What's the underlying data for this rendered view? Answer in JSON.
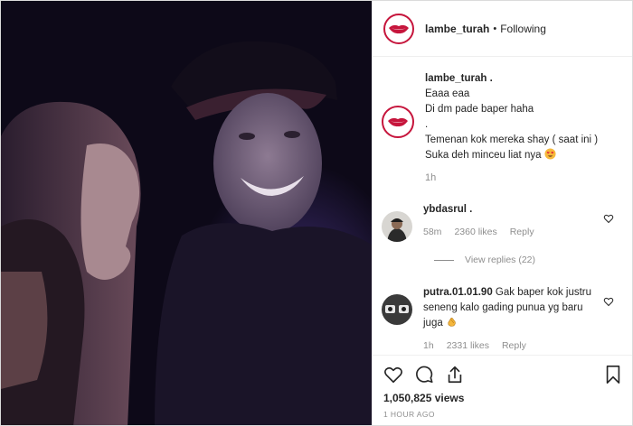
{
  "post": {
    "account": {
      "username": "lambe_turah",
      "separator": "•",
      "follow_status": "Following"
    },
    "caption": {
      "username": "lambe_turah .",
      "lines": [
        "Eaaa eaa",
        "Di dm pade baper haha",
        ".",
        "Temenan kok mereka shay ( saat ini )",
        "Suka deh minceu liat nya"
      ],
      "emoji": "heart-eyes-emoji",
      "time": "1h"
    },
    "comments": [
      {
        "username": "ybdasrul .",
        "text": "",
        "time": "58m",
        "likes": "2360 likes",
        "reply_label": "Reply",
        "view_replies": "View replies (22)"
      },
      {
        "username": "putra.01.01.90",
        "text": "Gak baper kok justru seneng kalo gading punua yg baru juga",
        "emoji": "clapping-hands-emoji",
        "time": "1h",
        "likes": "2331 likes",
        "reply_label": "Reply"
      }
    ],
    "actions": {
      "icons": [
        "heart-icon",
        "comment-icon",
        "share-icon",
        "bookmark-icon"
      ]
    },
    "views": "1,050,825 views",
    "posted_ago": "1 HOUR AGO"
  },
  "colors": {
    "accent": "#c6153c",
    "secondary_text": "#8e8e8e",
    "border": "#efefef"
  }
}
